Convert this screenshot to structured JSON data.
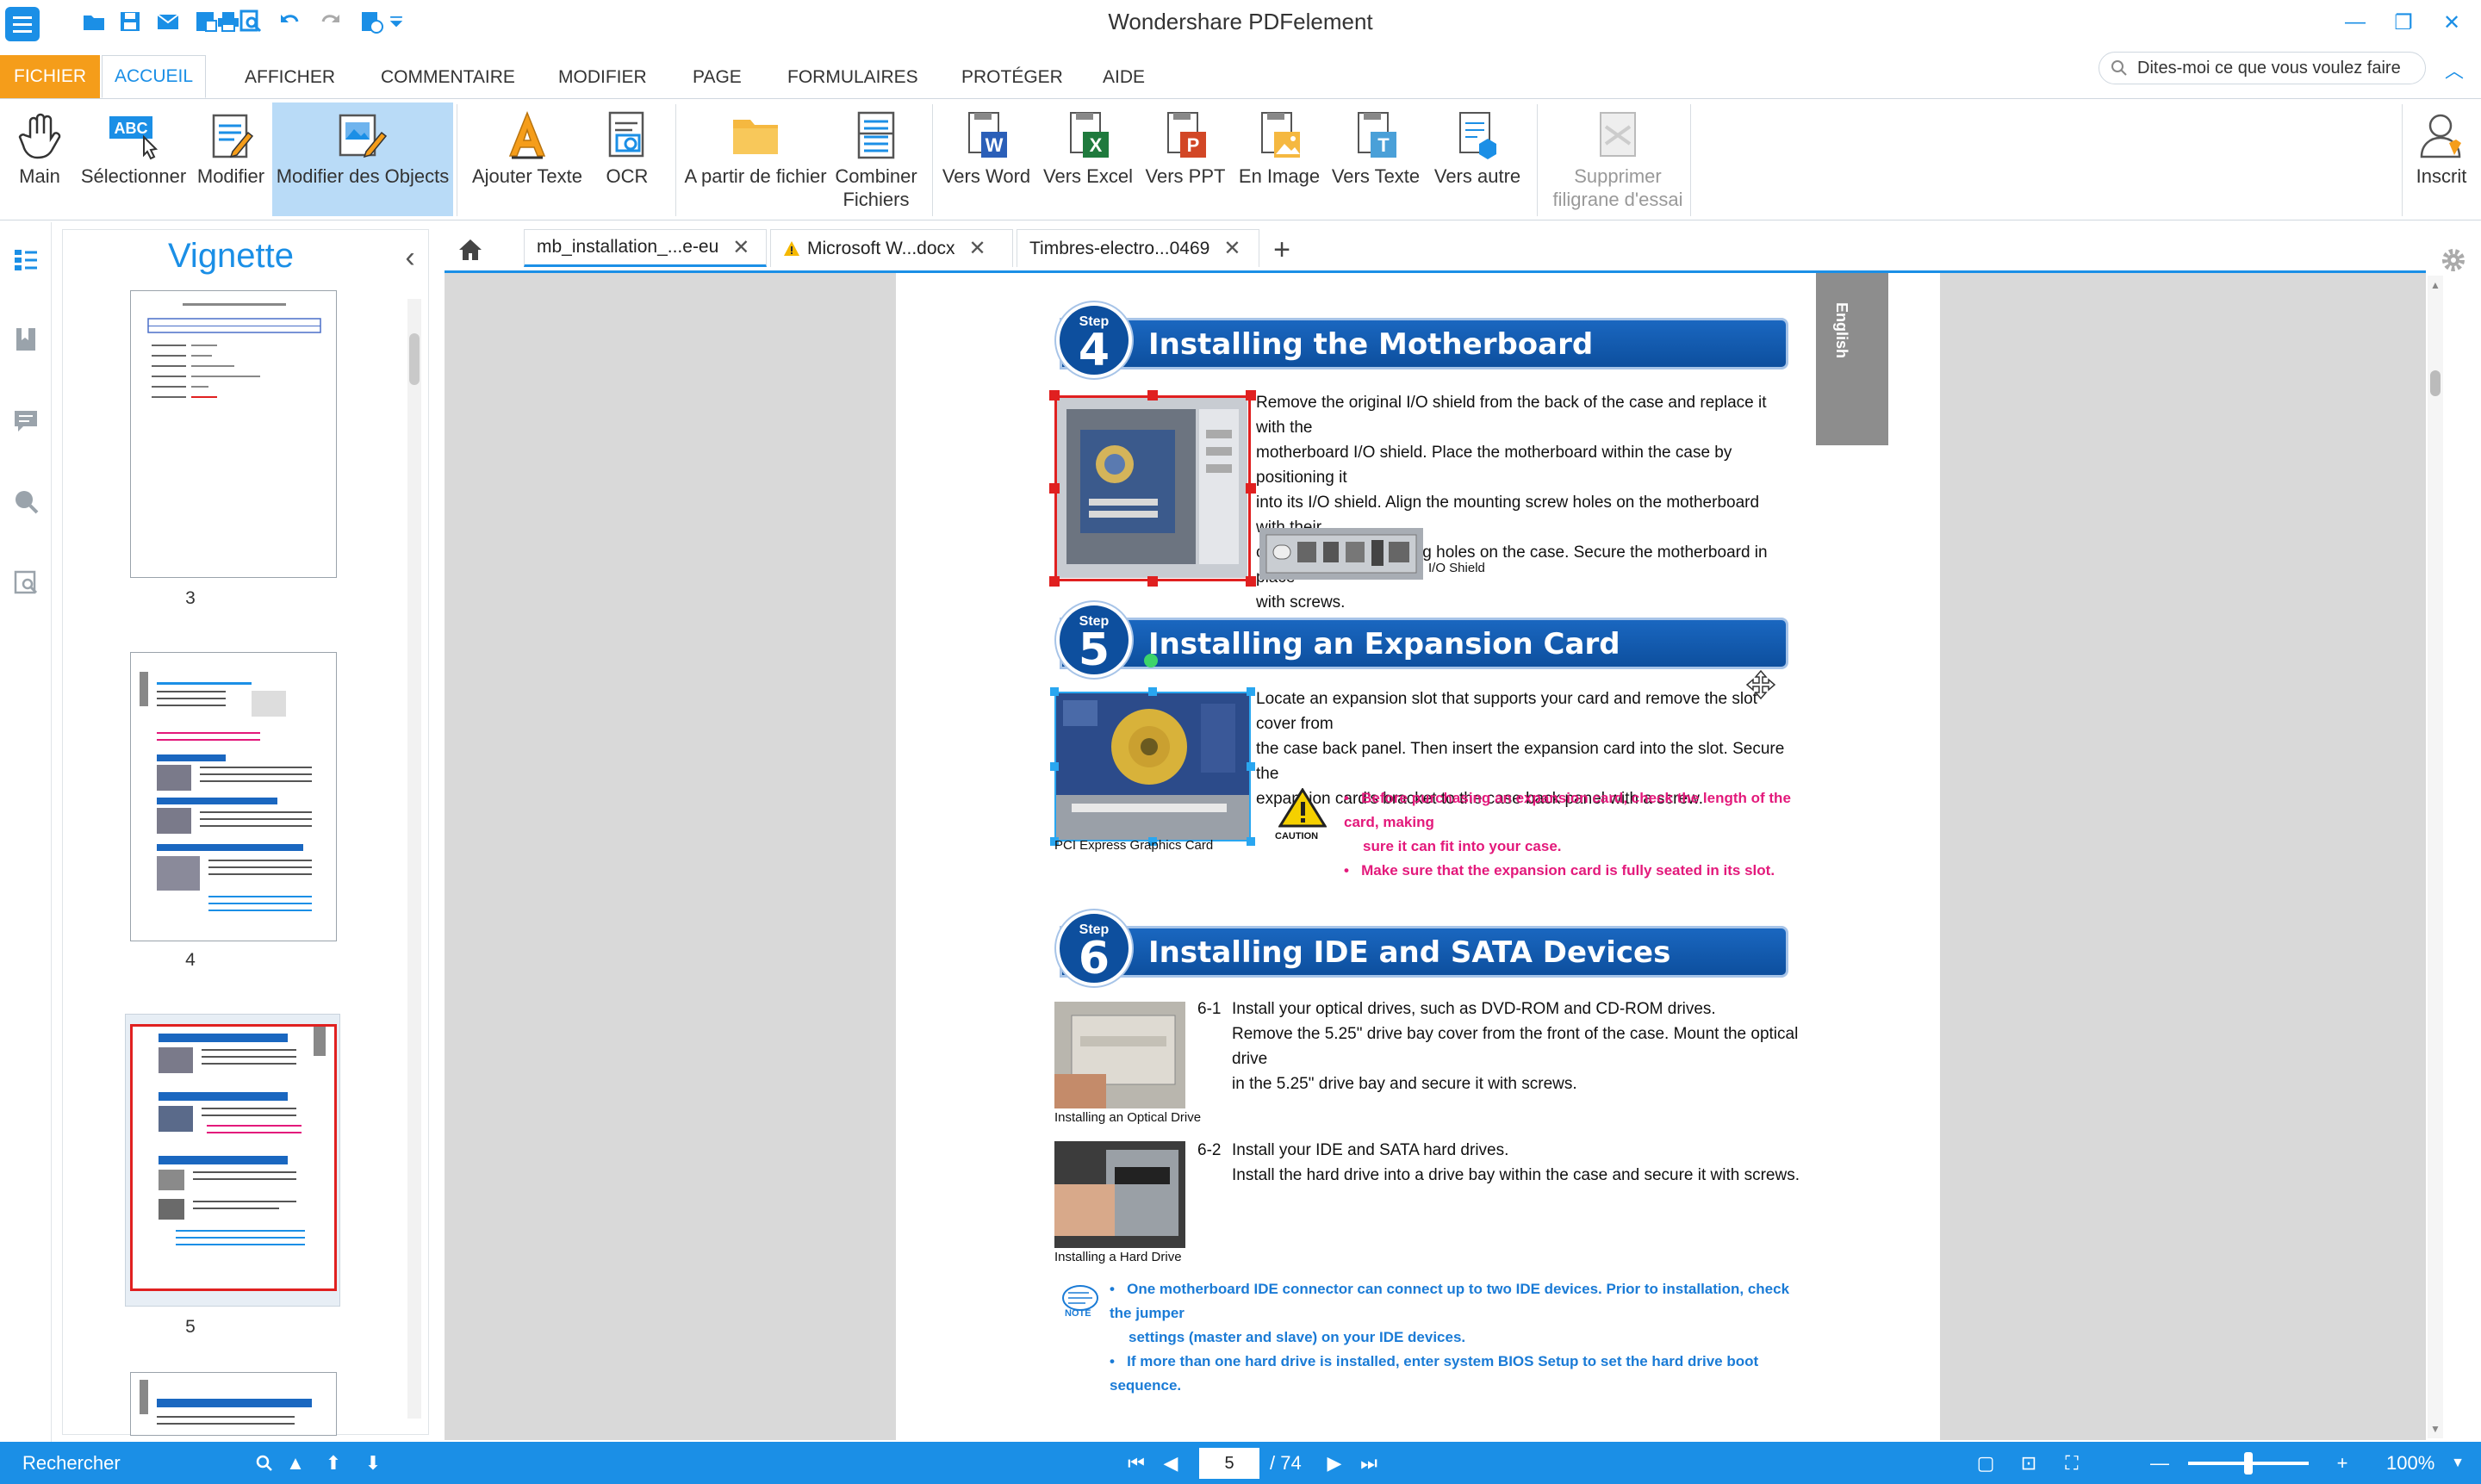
{
  "app": {
    "title": "Wondershare PDFelement"
  },
  "menu": {
    "fichier": "FICHIER",
    "tabs": [
      "ACCUEIL",
      "AFFICHER",
      "COMMENTAIRE",
      "MODIFIER",
      "PAGE",
      "FORMULAIRES",
      "PROTÉGER",
      "AIDE"
    ],
    "active_tab": "ACCUEIL",
    "help_search_placeholder": "Dites-moi ce que vous voulez faire"
  },
  "ribbon": {
    "main": "Main",
    "select": "Sélectionner",
    "edit": "Modifier",
    "edit_objects": "Modifier des Objects",
    "add_text": "Ajouter Texte",
    "ocr": "OCR",
    "from_file": "A partir de fichier",
    "combine_line1": "Combiner",
    "combine_line2": "Fichiers",
    "to_word": "Vers Word",
    "to_excel": "Vers Excel",
    "to_ppt": "Vers PPT",
    "to_image": "En Image",
    "to_text": "Vers Texte",
    "to_other": "Vers autre",
    "remove_wm_line1": "Supprimer",
    "remove_wm_line2": "filigrane d'essai",
    "signed_in": "Inscrit"
  },
  "thumbnails": {
    "title": "Vignette",
    "pages": [
      "3",
      "4",
      "5"
    ]
  },
  "doc_tabs": [
    {
      "label": "mb_installation_...e-eu",
      "active": true,
      "warning": false
    },
    {
      "label": "Microsoft W...docx",
      "active": false,
      "warning": true
    },
    {
      "label": "Timbres-electro...0469",
      "active": false,
      "warning": false
    }
  ],
  "document": {
    "lang_tab": "English",
    "step_word": "Step",
    "steps": [
      {
        "number": "4",
        "title": "Installing the Motherboard"
      },
      {
        "number": "5",
        "title": "Installing an Expansion Card"
      },
      {
        "number": "6",
        "title": "Installing IDE and SATA Devices"
      }
    ],
    "step4_text": [
      "Remove the original I/O shield from the back of the case and replace it with the",
      "motherboard I/O shield. Place the motherboard within the case by positioning it",
      "into its I/O shield. Align the mounting screw holes on the motherboard with their",
      "corresponding mounting holes on the case. Secure the motherboard in place",
      "with screws."
    ],
    "io_shield_caption": "I/O Shield",
    "step5_text": [
      "Locate an expansion slot that supports your card and remove the slot cover from",
      "the case back panel. Then insert the expansion card into the slot. Secure the",
      "expansion card's bracket to the case back panel with a screw."
    ],
    "caution_label": "CAUTION",
    "caution_items": [
      "Before purchasing an expansion card, check the length of the card, making",
      "sure it can fit into your case.",
      "Make sure that the expansion card is fully seated in its slot."
    ],
    "pci_caption": "PCI Express Graphics Card",
    "step6_1_num": "6-1",
    "step6_1_text": [
      "Install your optical drives, such as DVD-ROM and CD-ROM drives.",
      "Remove the 5.25\" drive bay cover from the front of the case. Mount the optical drive",
      "in the 5.25\" drive bay and secure it with screws."
    ],
    "optical_caption": "Installing an Optical Drive",
    "step6_2_num": "6-2",
    "step6_2_text": [
      "Install your IDE and SATA hard drives.",
      "Install the hard drive into a drive bay within the case and secure it with screws."
    ],
    "hdd_caption": "Installing a Hard Drive",
    "note_label": "NOTE",
    "note_items": [
      "One motherboard IDE connector can connect up to two IDE devices. Prior to installation, check the jumper",
      "settings (master and slave) on your IDE devices.",
      "If more than one hard drive is installed, enter system BIOS Setup to set the hard drive boot sequence."
    ]
  },
  "status": {
    "search_label": "Rechercher",
    "current_page": "5",
    "total_pages": "/ 74",
    "zoom": "100%",
    "zoom_fraction": 0.5
  },
  "colors": {
    "accent": "#1b8fe6",
    "fichier": "#f59d1a",
    "step_blue": "#0d4f9e",
    "warning_pink": "#e3197b",
    "note_blue": "#1a7bd6"
  }
}
